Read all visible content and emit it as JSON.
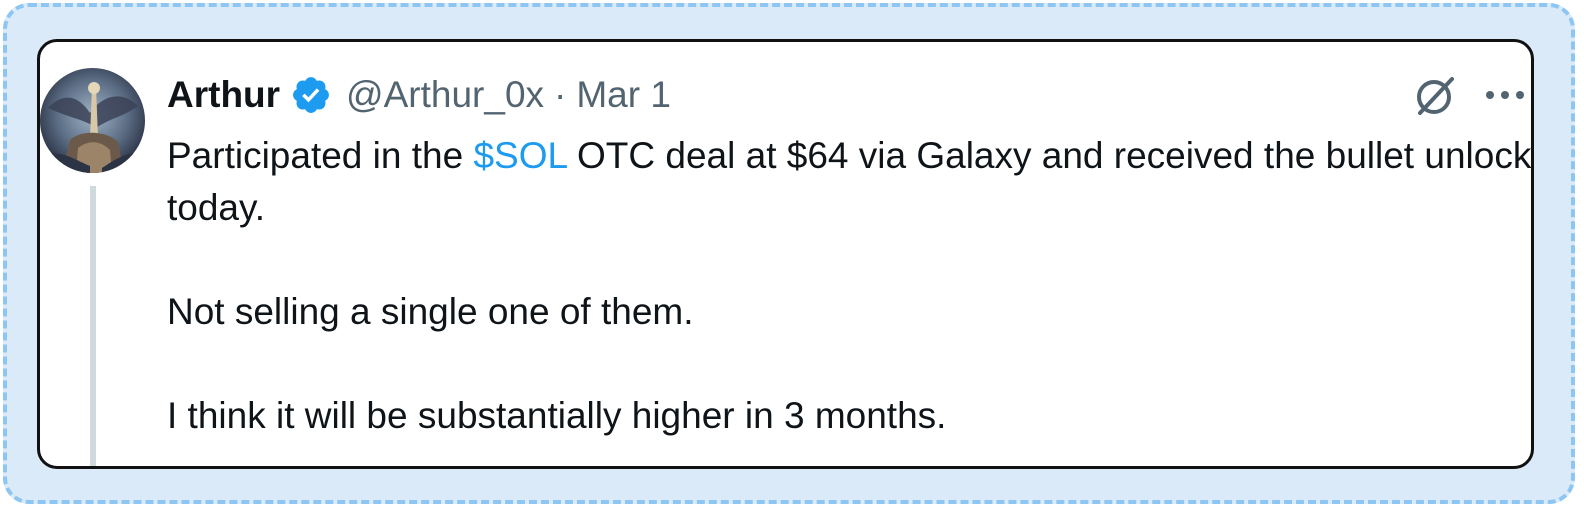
{
  "tweet": {
    "author_name": "Arthur",
    "handle": "@Arthur_0x",
    "separator": "·",
    "date": "Mar 1",
    "verified": true,
    "paragraph1": {
      "before": "Participated in the ",
      "cashtag": "$SOL",
      "after": " OTC deal at $64 via Galaxy and received the bullet unlock today."
    },
    "paragraph2": "Not selling a single one of them.",
    "paragraph3": "I think it will be substantially higher in 3 months."
  },
  "icons": {
    "avatar": "avatar-image",
    "verified": "verified-badge-icon",
    "grok": "grok-icon",
    "more": "more-options-icon"
  },
  "colors": {
    "accent": "#1d9bf0",
    "text": "#0f1419",
    "secondary_text": "#536471",
    "frame_border": "#8ec6f3",
    "frame_background": "#dbeaf9",
    "thread_line": "#cfd9de"
  }
}
